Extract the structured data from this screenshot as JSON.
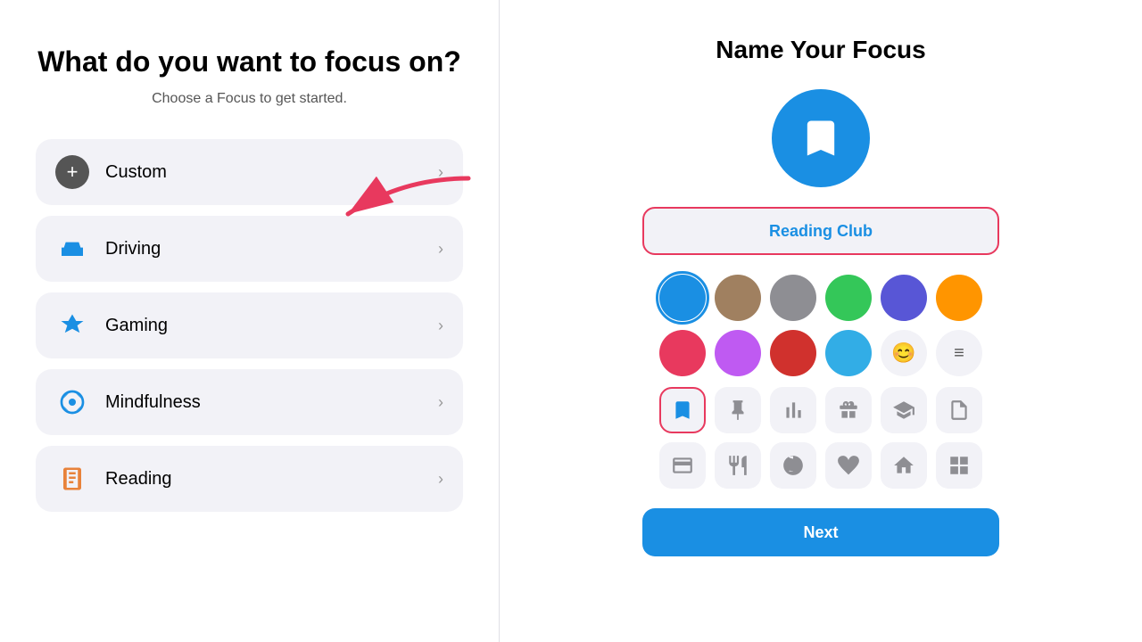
{
  "left": {
    "title": "What do you want to focus on?",
    "subtitle": "Choose a Focus to get started.",
    "items": [
      {
        "id": "custom",
        "label": "Custom",
        "icon": "plus",
        "icon_color": "#555"
      },
      {
        "id": "driving",
        "label": "Driving",
        "icon": "car",
        "icon_color": "#1a8fe3"
      },
      {
        "id": "gaming",
        "label": "Gaming",
        "icon": "rocket",
        "icon_color": "#1a8fe3"
      },
      {
        "id": "mindfulness",
        "label": "Mindfulness",
        "icon": "flower",
        "icon_color": "#1a8fe3"
      },
      {
        "id": "reading",
        "label": "Reading",
        "icon": "book",
        "icon_color": "#e8823a"
      }
    ]
  },
  "right": {
    "title": "Name Your Focus",
    "input_value": "Reading Club",
    "next_label": "Next",
    "colors": [
      {
        "id": "blue",
        "hex": "#1a8fe3",
        "selected": true
      },
      {
        "id": "tan",
        "hex": "#a08060",
        "selected": false
      },
      {
        "id": "gray",
        "hex": "#8e8e93",
        "selected": false
      },
      {
        "id": "green",
        "hex": "#34c759",
        "selected": false
      },
      {
        "id": "purple",
        "hex": "#5856d6",
        "selected": false
      },
      {
        "id": "orange",
        "hex": "#ff9500",
        "selected": false
      },
      {
        "id": "red",
        "hex": "#e8395e",
        "selected": false
      },
      {
        "id": "lavender",
        "hex": "#bf5af2",
        "selected": false
      },
      {
        "id": "crimson",
        "hex": "#d0312d",
        "selected": false
      },
      {
        "id": "teal",
        "hex": "#32ade6",
        "selected": false
      },
      {
        "id": "emoji",
        "hex": "#f2f2f7",
        "selected": false,
        "is_icon": true,
        "emoji": "😊"
      },
      {
        "id": "list",
        "hex": "#f2f2f7",
        "selected": false,
        "is_icon": true,
        "emoji": "≡"
      }
    ],
    "icons": [
      {
        "id": "bookmark",
        "selected": true
      },
      {
        "id": "pin",
        "selected": false
      },
      {
        "id": "chart",
        "selected": false
      },
      {
        "id": "gift",
        "selected": false
      },
      {
        "id": "grad",
        "selected": false
      },
      {
        "id": "doc",
        "selected": false
      },
      {
        "id": "card",
        "selected": false
      },
      {
        "id": "fork",
        "selected": false
      },
      {
        "id": "atom",
        "selected": false
      },
      {
        "id": "health",
        "selected": false
      },
      {
        "id": "home",
        "selected": false
      },
      {
        "id": "grid",
        "selected": false
      }
    ]
  }
}
